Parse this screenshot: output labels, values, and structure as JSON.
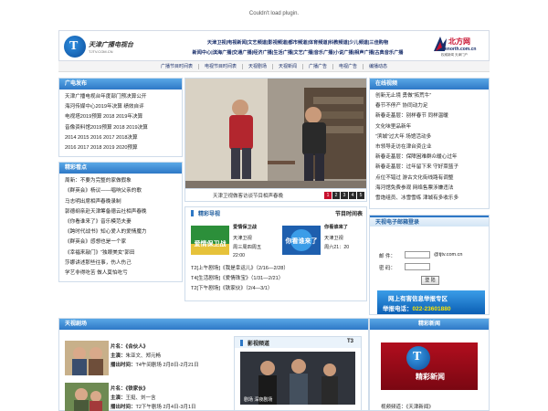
{
  "plugin_message": "Couldn't load plugin.",
  "header": {
    "logo_left_name": "天津广播电视台",
    "logo_left_sub": "TJTV.COM.CN",
    "nav_row1": "天津卫视|电视新闻|文艺频道|影视频道|都市频道|体育频道|科教频道|少儿频道|三佳购物",
    "nav_row2": "新闻中心|滨海广播|交通广播|经济广播|生活广播|文艺广播|音乐广播|小说广播|相声广播|古典音乐广播",
    "logo_right_cn": "北方网",
    "logo_right_url": "enorth.com.cn",
    "logo_right_slogan": "权威新闻 天津门户"
  },
  "subnav": [
    "广播节目时间表",
    "电视节目时间表",
    "天视剧场",
    "天视新闻",
    "广播广告",
    "电视广告",
    "编播动态"
  ],
  "broadcast": {
    "title": "广电发布",
    "items": [
      "天津广播电视台年度部门预决算公开",
      "海河传媒中心2019年决算 绩效自评",
      "电视塔2019预算 2018 2019年决算",
      "音像资料馆2019预算 2018 2019决算",
      "2014 2015 2016 2017 2018决算",
      "2016 2017 2018 2019 2020预算"
    ]
  },
  "highlights": {
    "title": "精彩看点",
    "items": [
      "周新：不要为完整的家做假象",
      "《群英会》杨议——唱响父亲的歌",
      "马志明出席相声春晚录制",
      "郭德纲亲赴天津筹备德云社相声春晚",
      "《你看谁来了》音乐模范夫妻",
      "《跨时代战书》知心爱人的爱情魔力",
      "《群英会》感想也是一个家",
      "《幸福来敲门》“独眼美女”郭田",
      "莎娜讲述那些往事，伤人伤己",
      "学艺非得吃苦 做人莫怕吃亏"
    ]
  },
  "slideshow": {
    "caption": "天津卫视做客访谈节目相声春晚",
    "pages": [
      "1",
      "2",
      "3",
      "4",
      "5"
    ],
    "active_page": "1"
  },
  "guide": {
    "title": "精彩导视",
    "right_title": "节目时间表",
    "programs": [
      {
        "thumb_text": "爱情保卫战",
        "title": "爱情保卫战",
        "channel": "天津卫视",
        "time": "周三周四周五",
        "time2": "22:00"
      },
      {
        "thumb_text": "你看谁来了",
        "title": "你看谁来了",
        "channel": "天津卫视",
        "time": "周六21：20",
        "time2": ""
      }
    ],
    "schedule": [
      "T2[上午剧场]《我是幸运儿》（2/16—2/28）",
      "T4[生活剧场]《爱情珠宝》（1/31—2/21）",
      "T2[下午剧场]《铁家伙》（2/4—3/1）"
    ]
  },
  "online": {
    "title": "在线视频",
    "items": [
      "创新无止境 勇做“拓荒牛”",
      "春节不停产 协同动力足",
      "新春走基层：别样春节 同样温暖",
      "文化味里品新年",
      "“滨城”过大年 场馆活动多",
      "市领导走访在津台资企业",
      "新春走基层：保障困难群众暖心过年",
      "新春走基层：过年留下来 守好菜篮子",
      "点位不错过 游古文化街线路有调整",
      "海河馆免费参观 网络售票涉嫌违法",
      "雪炮组员、冰雪雪练 津城有多收乐多"
    ]
  },
  "mail": {
    "title": "天视电子邮箱登录",
    "email_label": "邮  件：",
    "email_domain": "@tjtv.com.cn",
    "password_label": "密  码：",
    "submit_label": "登 陆",
    "report_line1": "网上有害信息举报专区",
    "report_line2_label": "举报电话：",
    "report_phone": "022-23601880"
  },
  "drama_section": {
    "title": "天视剧场",
    "items": [
      {
        "name_label": "片名：",
        "name": "《合伙人》",
        "cast_label": "主演：",
        "cast": "朱亚文、郑元畅",
        "air_label": "播出时间：",
        "air": "T4午间剧场 2月8日-2月21日"
      },
      {
        "name_label": "片名：",
        "name": "《铁家伙》",
        "cast_label": "主演：",
        "cast": "王挺、刘一含",
        "air_label": "播出时间：",
        "air": "T2下午剧场 2月4日-3月1日"
      }
    ]
  },
  "movie": {
    "title": "影视频道",
    "right": "T3",
    "caption": "剧场 深夜剧场"
  },
  "news": {
    "title": "精彩新闻",
    "logo_text": "精彩新闻",
    "video_label": "视频频道：",
    "video_name": "《天津新闻》"
  },
  "colors": {
    "accent_blue": "#2e78c6",
    "nav_text": "#1a2f6b",
    "brand_red": "#c8102e"
  }
}
